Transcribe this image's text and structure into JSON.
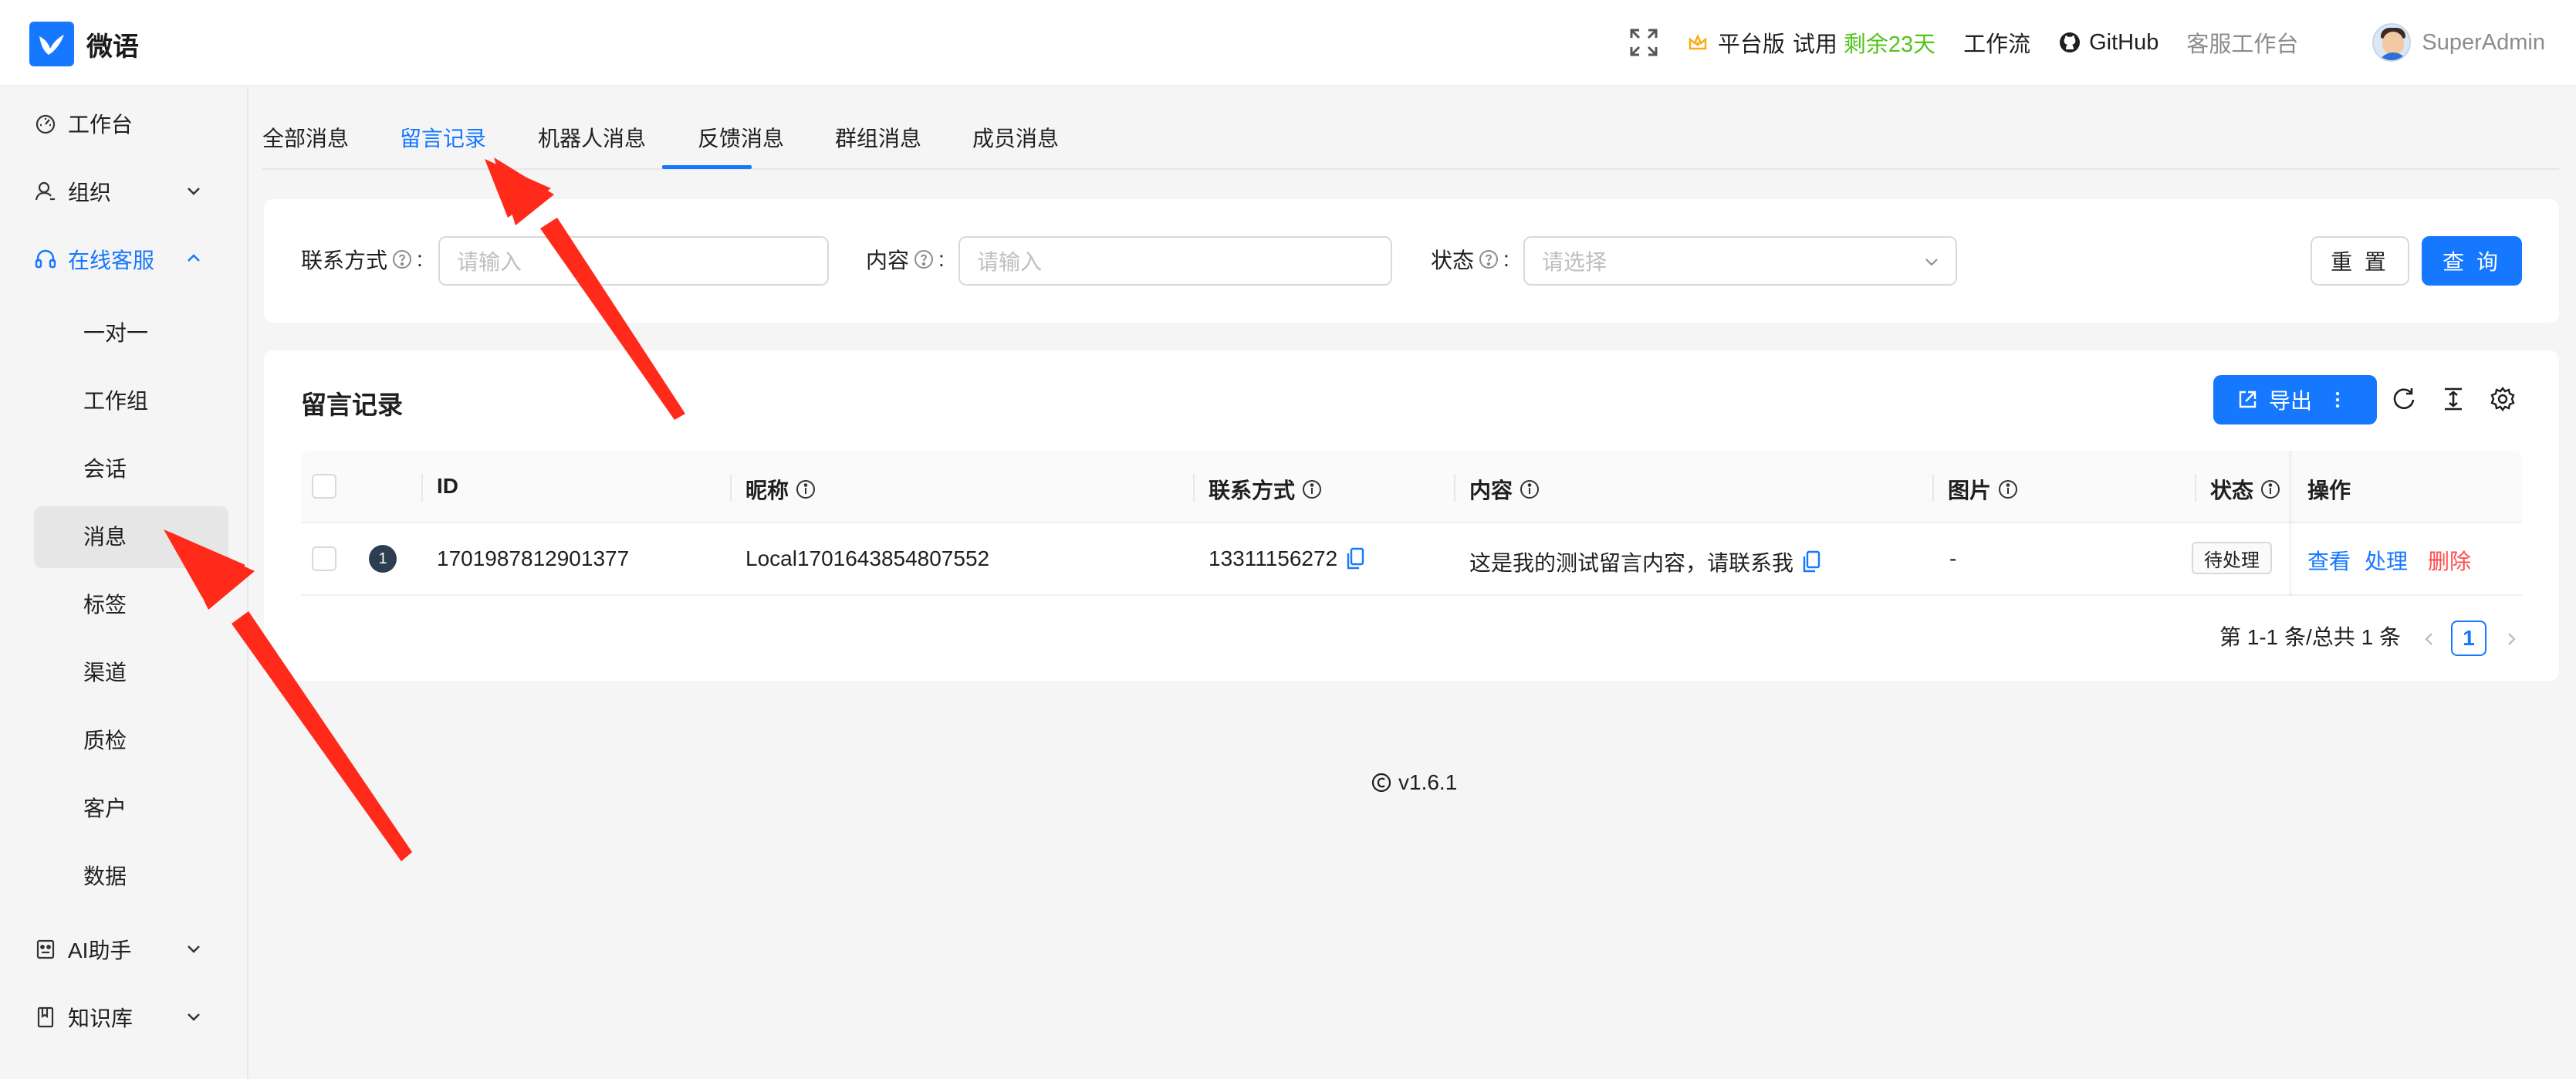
{
  "app": {
    "name": "微语"
  },
  "topbar": {
    "platform_label": "平台版",
    "trial_label": "试用",
    "trial_remaining": "剩余23天",
    "workflow": "工作流",
    "github": "GitHub",
    "agent_workbench": "客服工作台",
    "username": "SuperAdmin"
  },
  "sidebar": {
    "items": [
      {
        "label": "工作台",
        "icon": "dashboard-icon"
      },
      {
        "label": "组织",
        "icon": "organization-icon"
      },
      {
        "label": "在线客服",
        "icon": "headset-icon"
      },
      {
        "label": "AI助手",
        "icon": "robot-icon"
      },
      {
        "label": "知识库",
        "icon": "book-icon"
      }
    ],
    "subitems": [
      "一对一",
      "工作组",
      "会话",
      "消息",
      "标签",
      "渠道",
      "质检",
      "客户",
      "数据"
    ],
    "selected_subitem": "消息"
  },
  "tabs": [
    "全部消息",
    "留言记录",
    "机器人消息",
    "反馈消息",
    "群组消息",
    "成员消息"
  ],
  "active_tab": "留言记录",
  "filters": {
    "contact_label": "联系方式",
    "contact_placeholder": "请输入",
    "content_label": "内容",
    "content_placeholder": "请输入",
    "status_label": "状态",
    "status_placeholder": "请选择",
    "reset_label": "重 置",
    "query_label": "查 询",
    "colon": ":"
  },
  "table": {
    "title": "留言记录",
    "export_label": "导出",
    "columns": [
      "ID",
      "昵称",
      "联系方式",
      "内容",
      "图片",
      "状态",
      "操作"
    ],
    "rows": [
      {
        "index": "1",
        "id": "1701987812901377",
        "nickname": "Local1701643854807552",
        "contact": "13311156272",
        "content": "这是我的测试留言内容，请联系我",
        "image": "-",
        "status": "待处理",
        "actions": [
          "查看",
          "处理",
          "删除"
        ]
      }
    ],
    "pagination": {
      "summary": "第 1-1 条/总共 1 条",
      "current_page": "1"
    }
  },
  "footer": {
    "version": "v1.6.1"
  },
  "colors": {
    "primary": "#1677ff",
    "danger": "#ff4d4f",
    "trial": "#52c41a",
    "annotation_arrow": "#ff2a1a"
  }
}
